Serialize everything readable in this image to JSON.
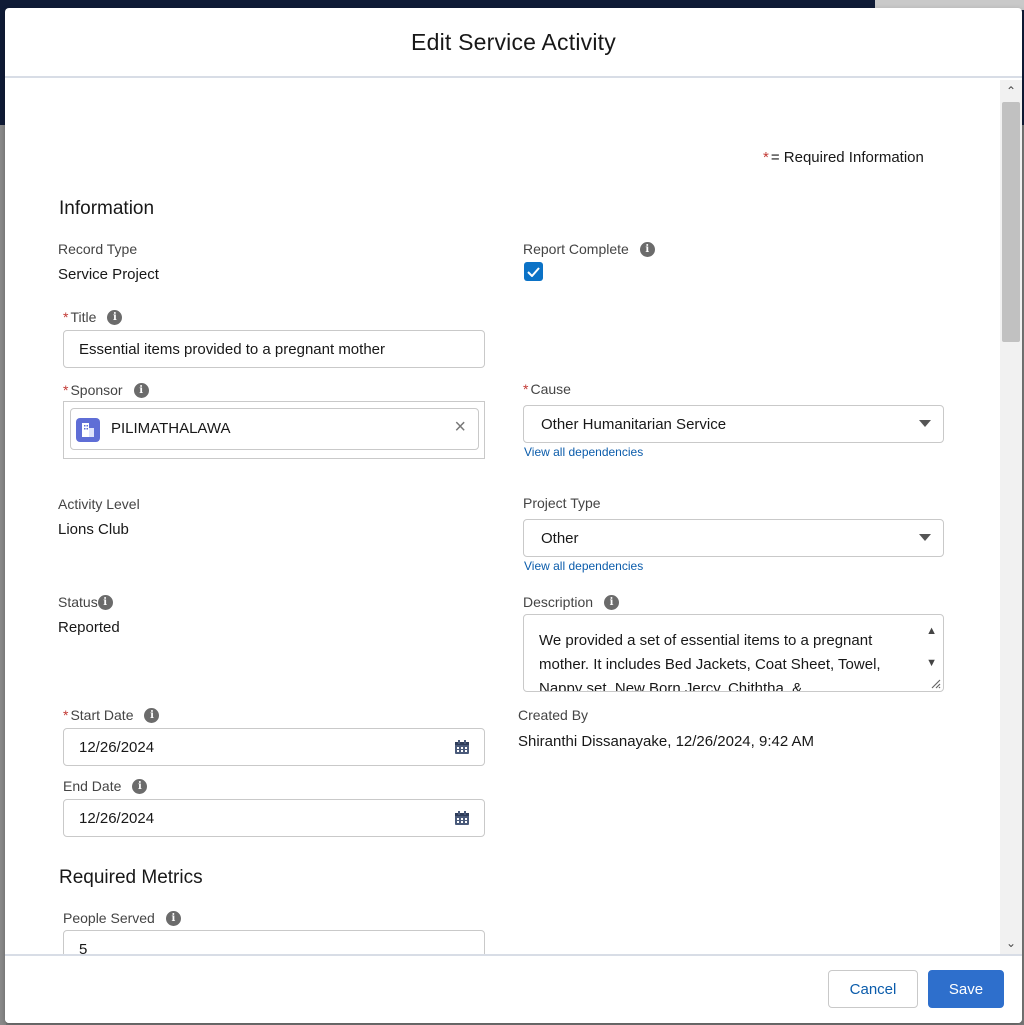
{
  "modal": {
    "title": "Edit Service Activity",
    "required_info_star": "*",
    "required_info_text": "= Required Information"
  },
  "sections": {
    "information": "Information",
    "required_metrics": "Required Metrics"
  },
  "fields": {
    "record_type": {
      "label": "Record Type",
      "value": "Service Project"
    },
    "report_complete": {
      "label": "Report Complete",
      "checked": true
    },
    "title": {
      "label": "Title",
      "value": "Essential items provided to a pregnant mother"
    },
    "sponsor": {
      "label": "Sponsor",
      "value": "PILIMATHALAWA"
    },
    "cause": {
      "label": "Cause",
      "value": "Other Humanitarian Service",
      "link": "View all dependencies"
    },
    "activity_level": {
      "label": "Activity Level",
      "value": "Lions Club"
    },
    "project_type": {
      "label": "Project Type",
      "value": "Other",
      "link": "View all dependencies"
    },
    "status": {
      "label": "Status",
      "value": "Reported"
    },
    "description": {
      "label": "Description",
      "value": "We provided a set of essential items to a pregnant mother. It includes Bed Jackets, Coat Sheet, Towel, Nappy set, New Born Jercy, Chiththa, &"
    },
    "start_date": {
      "label": "Start Date",
      "value": "12/26/2024"
    },
    "created_by": {
      "label": "Created By",
      "value": "Shiranthi Dissanayake, 12/26/2024, 9:42 AM"
    },
    "end_date": {
      "label": "End Date",
      "value": "12/26/2024"
    },
    "people_served": {
      "label": "People Served",
      "value": "5"
    }
  },
  "footer": {
    "cancel": "Cancel",
    "save": "Save"
  },
  "colors": {
    "accent": "#2e6fcc",
    "link": "#0b5cab",
    "required": "#c23934",
    "checkbox": "#0b72c6"
  },
  "icons": {
    "info": "i",
    "clear": "×"
  }
}
